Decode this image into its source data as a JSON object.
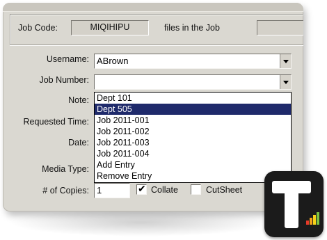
{
  "header": {
    "job_code_label": "Job Code:",
    "job_code_value": "MIQIHIPU",
    "files_label": "files in the Job",
    "files_value": ""
  },
  "form": {
    "username_label": "Username:",
    "username_value": "ABrown",
    "job_number_label": "Job Number:",
    "job_number_value": "",
    "note_label": "Note:",
    "requested_time_label": "Requested Time:",
    "date_label": "Date:",
    "media_type_label": "Media Type:",
    "copies_label": "# of Copies:",
    "copies_value": "1",
    "collate_label": "Collate",
    "collate_checked": true,
    "cutsheet_label": "CutSheet",
    "cutsheet_checked": false
  },
  "dropdown": {
    "options": [
      "Dept 101",
      "Dept 505",
      "Job 2011-001",
      "Job 2011-002",
      "Job 2011-003",
      "Job 2011-004",
      "Add Entry",
      "Remove Entry"
    ],
    "selected_index": 1
  },
  "logo": {
    "name": "T logo app icon"
  },
  "colors": {
    "window_bg": "#dad8d1",
    "selection": "#1f2a6b",
    "logo_bg": "#1b1b1b"
  }
}
